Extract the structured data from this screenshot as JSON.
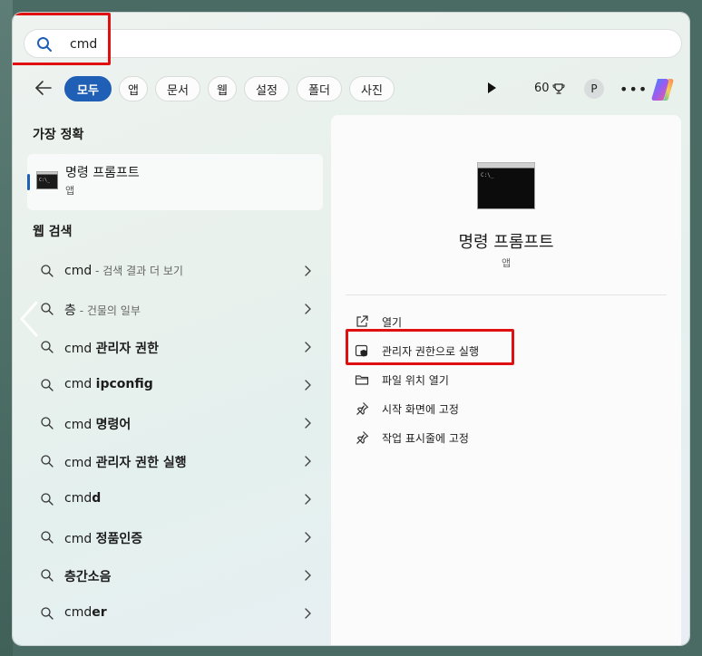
{
  "search": {
    "query": "cmd"
  },
  "filters": {
    "chips": [
      {
        "label": "모두",
        "active": true
      },
      {
        "label": "앱"
      },
      {
        "label": "문서"
      },
      {
        "label": "웹"
      },
      {
        "label": "설정"
      },
      {
        "label": "폴더"
      },
      {
        "label": "사진"
      }
    ],
    "points": "60"
  },
  "profile": {
    "initial": "P"
  },
  "best_match": {
    "section_title": "가장 정확",
    "title": "명령 프롬프트",
    "subtitle": "앱"
  },
  "web_search": {
    "section_title": "웹 검색",
    "results": [
      {
        "prefix": "cmd",
        "bold": "",
        "hint": " - 검색 결과 더 보기"
      },
      {
        "prefix": "층",
        "bold": "",
        "hint": " - 건물의 일부"
      },
      {
        "prefix": "cmd ",
        "bold": "관리자 권한",
        "hint": ""
      },
      {
        "prefix": "cmd ",
        "bold": "ipconfig",
        "hint": ""
      },
      {
        "prefix": "cmd ",
        "bold": "명령어",
        "hint": ""
      },
      {
        "prefix": "cmd ",
        "bold": "관리자 권한 실행",
        "hint": ""
      },
      {
        "prefix": "cmd",
        "bold": "d",
        "hint": ""
      },
      {
        "prefix": "cmd ",
        "bold": "정품인증",
        "hint": ""
      },
      {
        "prefix": "",
        "bold": "층간소음",
        "hint": ""
      },
      {
        "prefix": "cmd",
        "bold": "er",
        "hint": ""
      }
    ]
  },
  "preview": {
    "title": "명령 프롬프트",
    "subtitle": "앱",
    "actions": [
      {
        "label": "열기",
        "icon": "open-external-icon"
      },
      {
        "label": "관리자 권한으로 실행",
        "icon": "shield-admin-icon"
      },
      {
        "label": "파일 위치 열기",
        "icon": "folder-icon"
      },
      {
        "label": "시작 화면에 고정",
        "icon": "pin-icon"
      },
      {
        "label": "작업 표시줄에 고정",
        "icon": "pin-icon"
      }
    ]
  },
  "colors": {
    "accent": "#1f5fb5",
    "highlight": "#e01010"
  }
}
